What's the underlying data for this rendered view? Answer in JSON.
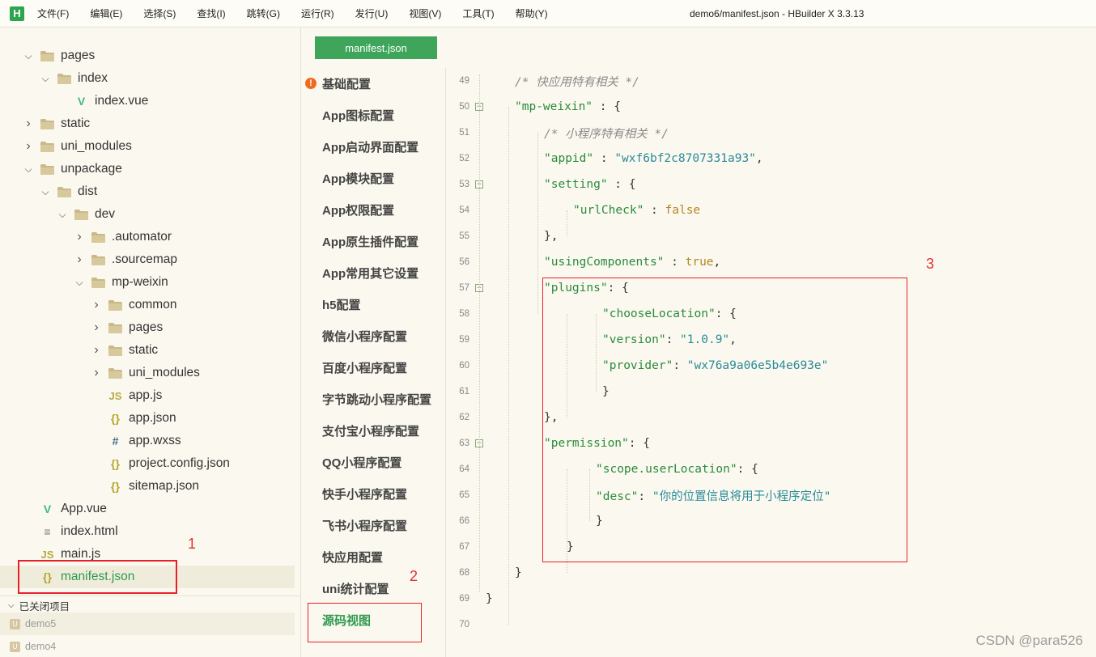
{
  "menubar": {
    "logo": "H",
    "items": [
      "文件(F)",
      "编辑(E)",
      "选择(S)",
      "查找(I)",
      "跳转(G)",
      "运行(R)",
      "发行(U)",
      "视图(V)",
      "工具(T)",
      "帮助(Y)"
    ],
    "window_title": "demo6/manifest.json - HBuilder X 3.3.13"
  },
  "tree": {
    "items": [
      {
        "label": "pages",
        "type": "folder",
        "state": "expanded"
      },
      {
        "label": "index",
        "type": "folder",
        "state": "expanded"
      },
      {
        "label": "index.vue",
        "type": "vue"
      },
      {
        "label": "static",
        "type": "folder",
        "state": "collapsed"
      },
      {
        "label": "uni_modules",
        "type": "folder",
        "state": "collapsed"
      },
      {
        "label": "unpackage",
        "type": "folder",
        "state": "expanded"
      },
      {
        "label": "dist",
        "type": "folder",
        "state": "expanded"
      },
      {
        "label": "dev",
        "type": "folder",
        "state": "expanded"
      },
      {
        "label": ".automator",
        "type": "folder",
        "state": "collapsed"
      },
      {
        "label": ".sourcemap",
        "type": "folder",
        "state": "collapsed"
      },
      {
        "label": "mp-weixin",
        "type": "folder",
        "state": "expanded"
      },
      {
        "label": "common",
        "type": "folder",
        "state": "collapsed"
      },
      {
        "label": "pages",
        "type": "folder",
        "state": "collapsed"
      },
      {
        "label": "static",
        "type": "folder",
        "state": "collapsed"
      },
      {
        "label": "uni_modules",
        "type": "folder",
        "state": "collapsed"
      },
      {
        "label": "app.js",
        "type": "js"
      },
      {
        "label": "app.json",
        "type": "json"
      },
      {
        "label": "app.wxss",
        "type": "css"
      },
      {
        "label": "project.config.json",
        "type": "json"
      },
      {
        "label": "sitemap.json",
        "type": "json"
      },
      {
        "label": "App.vue",
        "type": "vue"
      },
      {
        "label": "index.html",
        "type": "html"
      },
      {
        "label": "main.js",
        "type": "js"
      },
      {
        "label": "manifest.json",
        "type": "json",
        "selected": true
      }
    ],
    "closed_header": "已关闭项目",
    "closed_projects": [
      "demo5",
      "demo4"
    ]
  },
  "tab": {
    "label": "manifest.json"
  },
  "config_nav": {
    "items": [
      "基础配置",
      "App图标配置",
      "App启动界面配置",
      "App模块配置",
      "App权限配置",
      "App原生插件配置",
      "App常用其它设置",
      "h5配置",
      "微信小程序配置",
      "百度小程序配置",
      "字节跳动小程序配置",
      "支付宝小程序配置",
      "QQ小程序配置",
      "快手小程序配置",
      "飞书小程序配置",
      "快应用配置",
      "uni统计配置",
      "源码视图"
    ],
    "active_index": 17,
    "warning_index": 0,
    "warning_symbol": "!"
  },
  "editor": {
    "lines": [
      {
        "n": "49",
        "text": "/* 快应用特有相关 */"
      },
      {
        "n": "50",
        "text": "\"mp-weixin\" : {"
      },
      {
        "n": "51",
        "text": "/* 小程序特有相关 */"
      },
      {
        "n": "52",
        "text": "\"appid\" : \"wxf6bf2c8707331a93\","
      },
      {
        "n": "53",
        "text": "\"setting\" : {"
      },
      {
        "n": "54",
        "text": "\"urlCheck\" : false"
      },
      {
        "n": "55",
        "text": "},"
      },
      {
        "n": "56",
        "text": "\"usingComponents\" : true,"
      },
      {
        "n": "57",
        "text": "\"plugins\": {"
      },
      {
        "n": "58",
        "text": "\"chooseLocation\": {"
      },
      {
        "n": "59",
        "text": "\"version\": \"1.0.9\","
      },
      {
        "n": "60",
        "text": "\"provider\": \"wx76a9a06e5b4e693e\""
      },
      {
        "n": "61",
        "text": "}"
      },
      {
        "n": "62",
        "text": "},"
      },
      {
        "n": "63",
        "text": "\"permission\": {"
      },
      {
        "n": "64",
        "text": "\"scope.userLocation\": {"
      },
      {
        "n": "65",
        "text": "\"desc\": \"你的位置信息将用于小程序定位\""
      },
      {
        "n": "66",
        "text": "}"
      },
      {
        "n": "67",
        "text": "}"
      },
      {
        "n": "68",
        "text": "}"
      },
      {
        "n": "69",
        "text": "}"
      },
      {
        "n": "70",
        "text": ""
      }
    ],
    "fold_markers": [
      "50",
      "53",
      "57",
      "63"
    ]
  },
  "annotations": {
    "one": "1",
    "two": "2",
    "three": "3"
  },
  "watermark": "CSDN @para526",
  "colors": {
    "accent_green": "#3ea55a",
    "annotation_red": "#e8202a",
    "warning_orange": "#f06a1f"
  }
}
